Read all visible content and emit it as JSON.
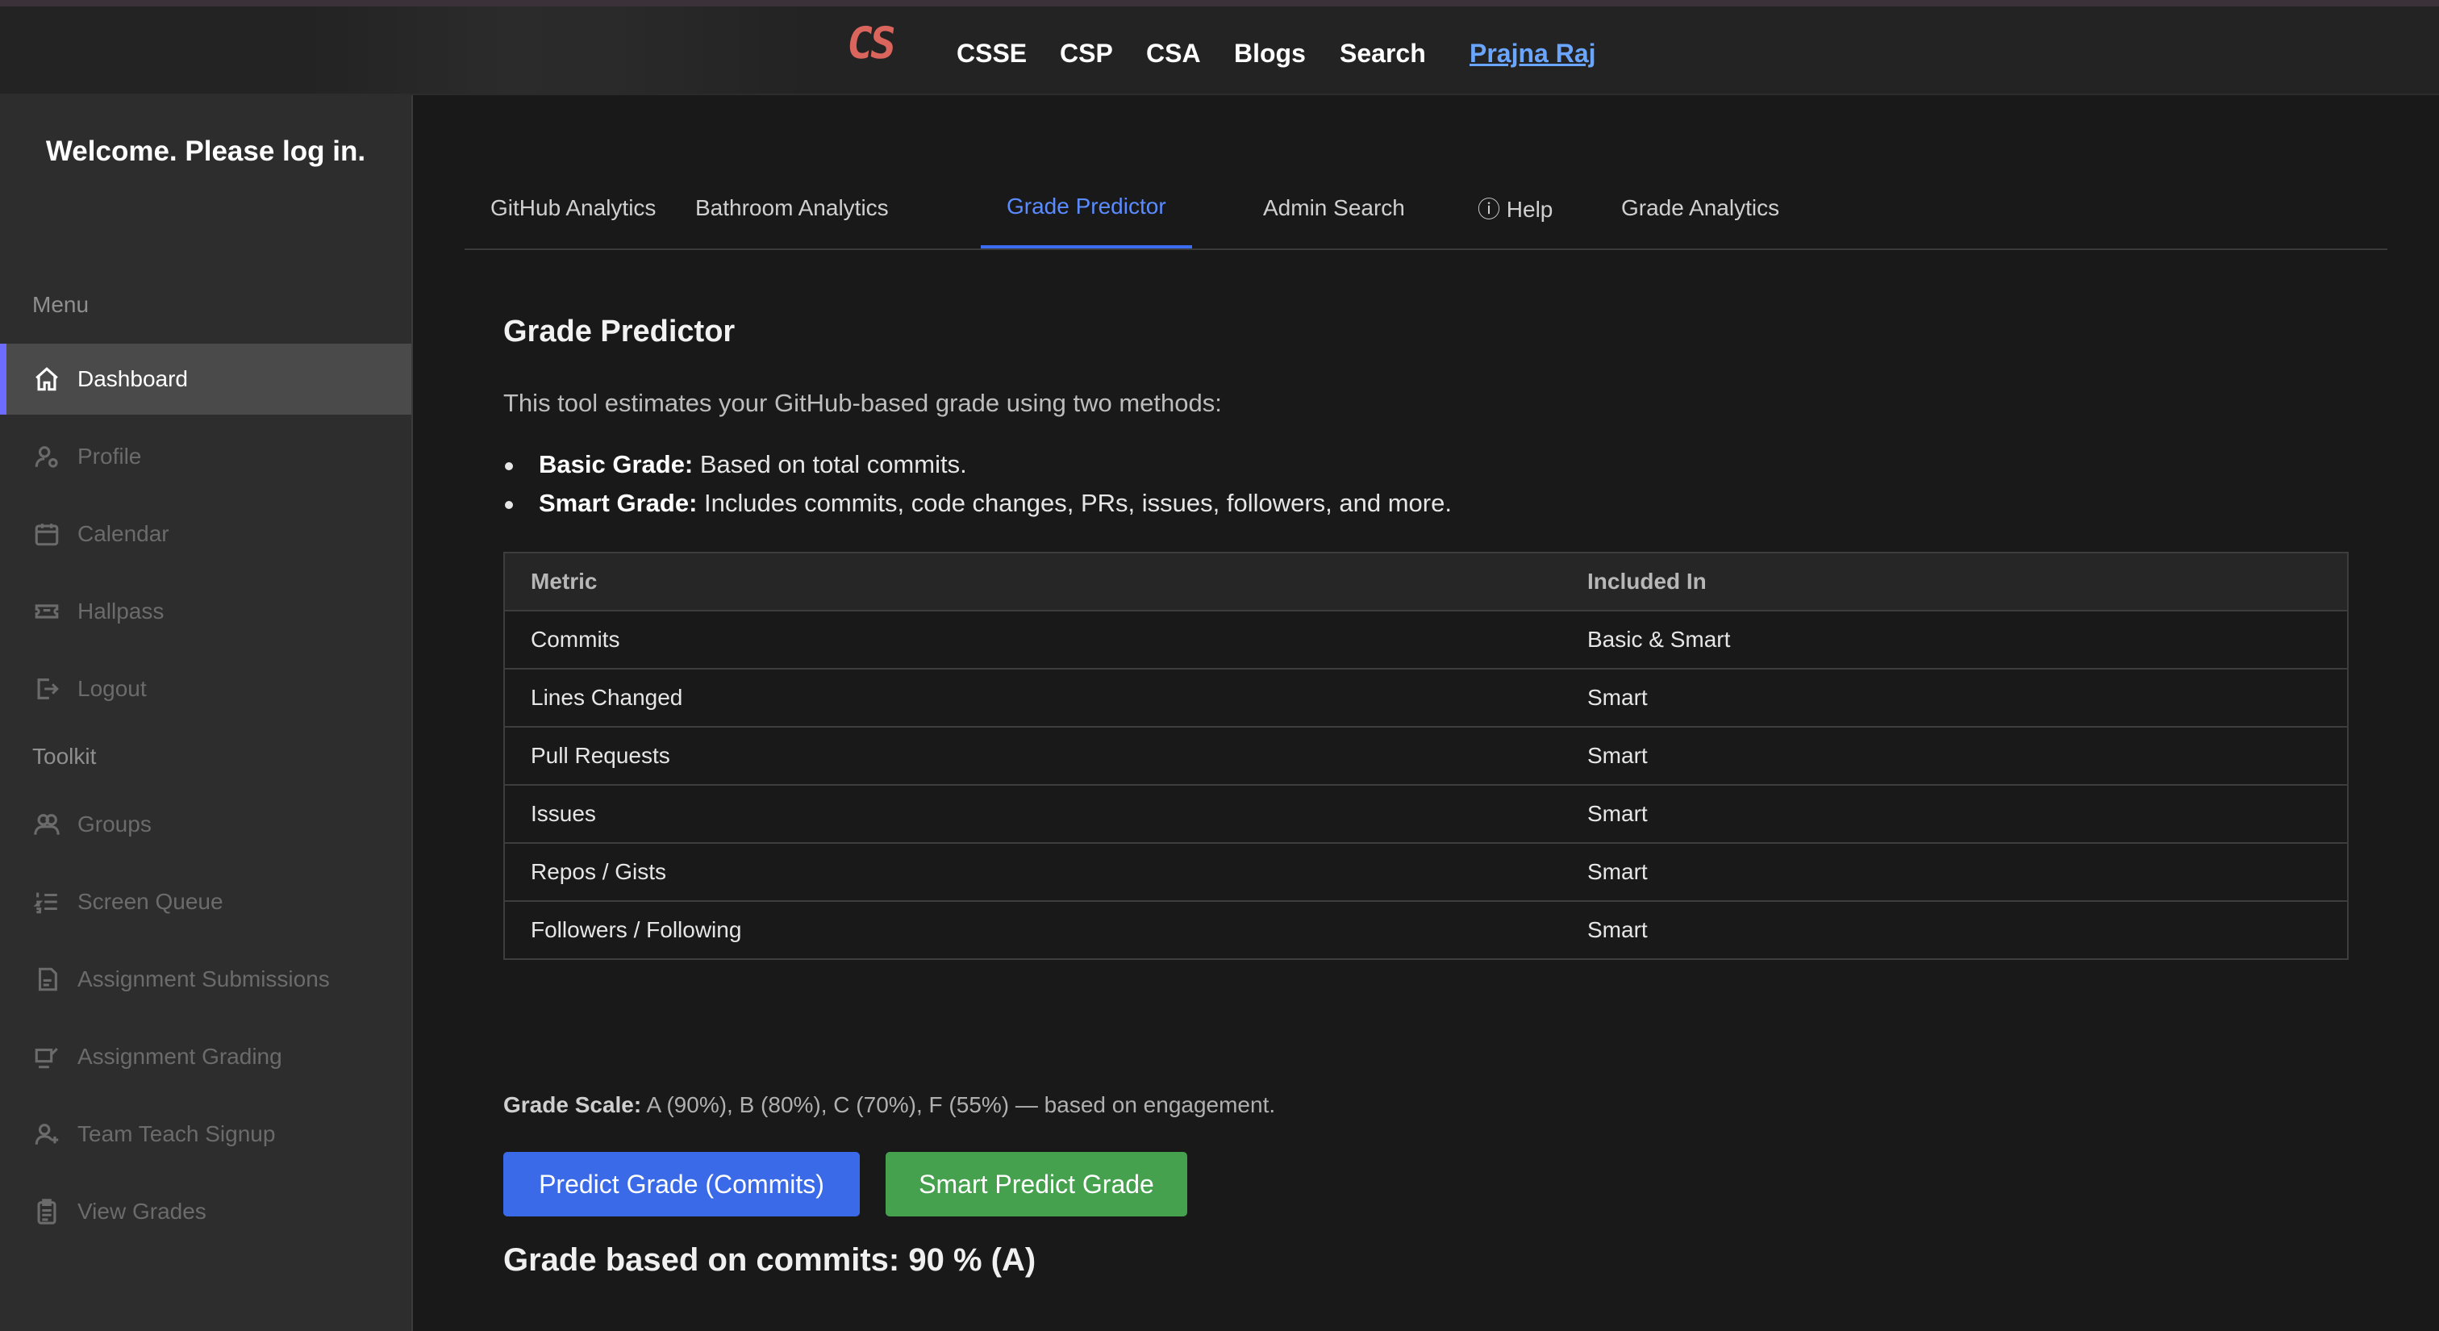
{
  "topnav": {
    "logo": "CS",
    "links": [
      "CSSE",
      "CSP",
      "CSA",
      "Blogs",
      "Search"
    ],
    "user": "Prajna Raj"
  },
  "sidebar": {
    "welcome": "Welcome. Please log in.",
    "menu_label": "Menu",
    "menu_items": [
      {
        "label": "Dashboard",
        "icon": "home-icon",
        "active": true
      },
      {
        "label": "Profile",
        "icon": "user-gear-icon"
      },
      {
        "label": "Calendar",
        "icon": "calendar-icon"
      },
      {
        "label": "Hallpass",
        "icon": "ticket-icon"
      },
      {
        "label": "Logout",
        "icon": "logout-icon"
      }
    ],
    "toolkit_label": "Toolkit",
    "toolkit_items": [
      {
        "label": "Groups",
        "icon": "users-icon"
      },
      {
        "label": "Screen Queue",
        "icon": "ordered-list-icon"
      },
      {
        "label": "Assignment Submissions",
        "icon": "submission-icon"
      },
      {
        "label": "Assignment Grading",
        "icon": "grading-icon"
      },
      {
        "label": "Team Teach Signup",
        "icon": "user-plus-icon"
      },
      {
        "label": "View Grades",
        "icon": "clipboard-icon"
      }
    ]
  },
  "page": {
    "title_partial": "Dashboard"
  },
  "tabs": [
    {
      "label": "GitHub Analytics"
    },
    {
      "label": "Bathroom Analytics"
    },
    {
      "label": "Grade Predictor",
      "active": true
    },
    {
      "label": "Admin Search"
    },
    {
      "label": "ⓘ Help"
    },
    {
      "label": "Grade Analytics"
    }
  ],
  "predictor": {
    "heading": "Grade Predictor",
    "intro": "This tool estimates your GitHub-based grade using two methods:",
    "bullets": [
      {
        "term": "Basic Grade:",
        "text": " Based on total commits."
      },
      {
        "term": "Smart Grade:",
        "text": " Includes commits, code changes, PRs, issues, followers, and more."
      }
    ],
    "table": {
      "headers": [
        "Metric",
        "Included In"
      ],
      "rows": [
        [
          "Commits",
          "Basic & Smart"
        ],
        [
          "Lines Changed",
          "Smart"
        ],
        [
          "Pull Requests",
          "Smart"
        ],
        [
          "Issues",
          "Smart"
        ],
        [
          "Repos / Gists",
          "Smart"
        ],
        [
          "Followers / Following",
          "Smart"
        ]
      ]
    },
    "scale_label": "Grade Scale:",
    "scale_text": " A (90%), B (80%), C (70%), F (55%) — based on engagement.",
    "predict_button": "Predict Grade (Commits)",
    "smart_button": "Smart Predict Grade",
    "result": "Grade based on commits: 90 % (A)"
  },
  "colors": {
    "accent": "#3c6df0",
    "primary_button": "#3a6ae8",
    "success_button": "#46a14f",
    "logo": "#d9655c",
    "active_indicator": "#6e6bff"
  }
}
